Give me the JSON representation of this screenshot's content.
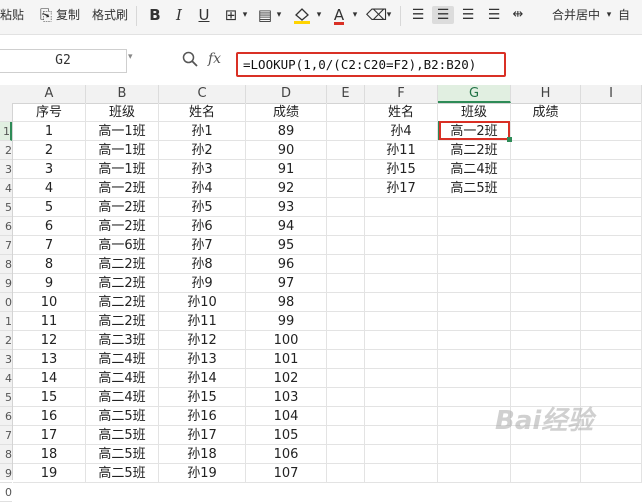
{
  "ribbon": {
    "paste_label": "粘贴",
    "copy_label": "复制",
    "format_painter_label": "格式刷",
    "bold_label": "B",
    "italic_label": "I",
    "underline_label": "U",
    "font_color_letter": "A",
    "merge_center_label": "合并居中",
    "wrap_label": "自",
    "dropdown_glyph": "▾",
    "accent_red": "#d93025"
  },
  "formula_bar": {
    "name_box": "G2",
    "fx_label": "fx",
    "formula": "=LOOKUP(1,0/(C2:C20=F2),B2:B20)"
  },
  "grid": {
    "columns": [
      "A",
      "B",
      "C",
      "D",
      "E",
      "F",
      "G",
      "H",
      "I"
    ],
    "selected_column": "G",
    "row_numbers": [
      "",
      "1",
      "2",
      "3",
      "4",
      "5",
      "6",
      "7",
      "8",
      "9",
      "0",
      "1",
      "2",
      "3",
      "4",
      "5",
      "6",
      "7",
      "8",
      "9",
      "0"
    ],
    "header_row": [
      "序号",
      "班级",
      "姓名",
      "成绩",
      "",
      "姓名",
      "班级",
      "成绩",
      ""
    ],
    "rows": [
      [
        "1",
        "高一1班",
        "孙1",
        "89",
        "",
        "孙4",
        "高一2班",
        "",
        ""
      ],
      [
        "2",
        "高一1班",
        "孙2",
        "90",
        "",
        "孙11",
        "高二2班",
        "",
        ""
      ],
      [
        "3",
        "高一1班",
        "孙3",
        "91",
        "",
        "孙15",
        "高二4班",
        "",
        ""
      ],
      [
        "4",
        "高一2班",
        "孙4",
        "92",
        "",
        "孙17",
        "高二5班",
        "",
        ""
      ],
      [
        "5",
        "高一2班",
        "孙5",
        "93",
        "",
        "",
        "",
        "",
        ""
      ],
      [
        "6",
        "高一2班",
        "孙6",
        "94",
        "",
        "",
        "",
        "",
        ""
      ],
      [
        "7",
        "高一6班",
        "孙7",
        "95",
        "",
        "",
        "",
        "",
        ""
      ],
      [
        "8",
        "高二2班",
        "孙8",
        "96",
        "",
        "",
        "",
        "",
        ""
      ],
      [
        "9",
        "高二2班",
        "孙9",
        "97",
        "",
        "",
        "",
        "",
        ""
      ],
      [
        "10",
        "高二2班",
        "孙10",
        "98",
        "",
        "",
        "",
        "",
        ""
      ],
      [
        "11",
        "高二2班",
        "孙11",
        "99",
        "",
        "",
        "",
        "",
        ""
      ],
      [
        "12",
        "高二3班",
        "孙12",
        "100",
        "",
        "",
        "",
        "",
        ""
      ],
      [
        "13",
        "高二4班",
        "孙13",
        "101",
        "",
        "",
        "",
        "",
        ""
      ],
      [
        "14",
        "高二4班",
        "孙14",
        "102",
        "",
        "",
        "",
        "",
        ""
      ],
      [
        "15",
        "高二4班",
        "孙15",
        "103",
        "",
        "",
        "",
        "",
        ""
      ],
      [
        "16",
        "高二5班",
        "孙16",
        "104",
        "",
        "",
        "",
        "",
        ""
      ],
      [
        "17",
        "高二5班",
        "孙17",
        "105",
        "",
        "",
        "",
        "",
        ""
      ],
      [
        "18",
        "高二5班",
        "孙18",
        "106",
        "",
        "",
        "",
        "",
        ""
      ],
      [
        "19",
        "高二5班",
        "孙19",
        "107",
        "",
        "",
        "",
        "",
        ""
      ]
    ]
  },
  "watermark": "Bai经验"
}
